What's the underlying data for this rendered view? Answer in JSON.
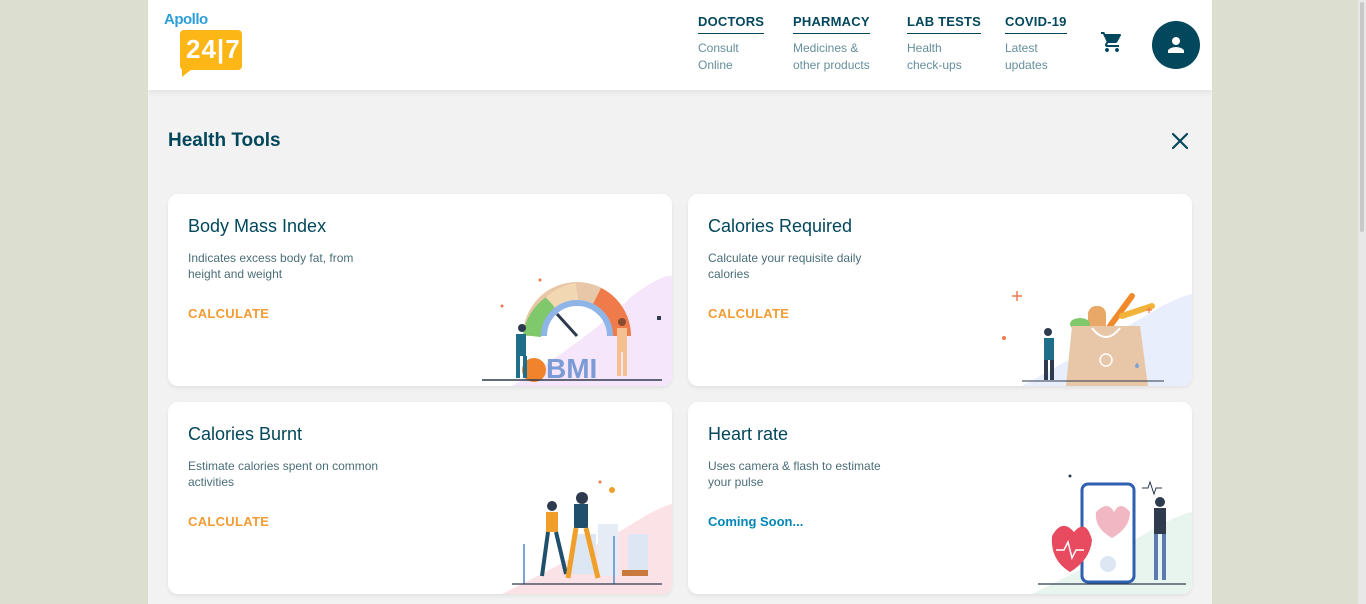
{
  "logo": {
    "brand": "Apollo",
    "badge": "24|7"
  },
  "nav": [
    {
      "title": "DOCTORS",
      "sub1": "Consult",
      "sub2": "Online"
    },
    {
      "title": "PHARMACY",
      "sub1": "Medicines &",
      "sub2": "other products"
    },
    {
      "title": "LAB TESTS",
      "sub1": "Health",
      "sub2": "check-ups"
    },
    {
      "title": "COVID-19",
      "sub1": "Latest",
      "sub2": "updates"
    }
  ],
  "icons": {
    "cart": "cart-icon",
    "avatar": "user-icon",
    "close": "close-icon"
  },
  "page": {
    "title": "Health Tools"
  },
  "cards": [
    {
      "title": "Body Mass Index",
      "desc1": "Indicates excess body fat, from",
      "desc2": "height and weight",
      "action": "CALCULATE",
      "illus_text": "BMI"
    },
    {
      "title": "Calories Required",
      "desc1": "Calculate your requisite daily",
      "desc2": "calories",
      "action": "CALCULATE"
    },
    {
      "title": "Calories Burnt",
      "desc1": "Estimate calories spent on common",
      "desc2": "activities",
      "action": "CALCULATE"
    },
    {
      "title": "Heart rate",
      "desc1": "Uses camera & flash to estimate",
      "desc2": "your pulse",
      "action": "Coming Soon..."
    }
  ],
  "colors": {
    "primary": "#02475b",
    "accent": "#f39c33",
    "link": "#0087ba",
    "logo_yellow": "#fcb716",
    "logo_blue": "#2c9fd8"
  }
}
